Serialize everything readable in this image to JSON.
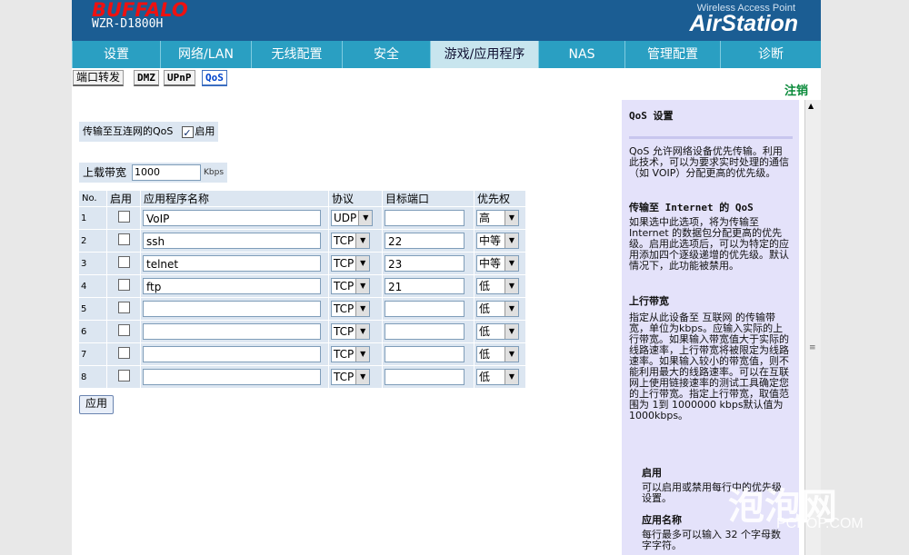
{
  "header": {
    "brand_logo": "BUFFALO",
    "model": "WZR-D1800H",
    "subtitle": "Wireless Access Point",
    "product": "AirStation"
  },
  "nav": [
    {
      "label": "设置",
      "w": 97
    },
    {
      "label": "网络/LAN",
      "w": 100
    },
    {
      "label": "无线配置",
      "w": 100
    },
    {
      "label": "安全",
      "w": 97
    },
    {
      "label": "游戏/应用程序",
      "w": 119,
      "active": true
    },
    {
      "label": "NAS",
      "w": 95
    },
    {
      "label": "管理配置",
      "w": 105
    },
    {
      "label": "诊断",
      "w": 111
    }
  ],
  "subnav": {
    "port_forward": "端口转发",
    "dmz": "DMZ",
    "upnp": "UPnP",
    "qos": "QoS",
    "logout": "注销"
  },
  "qos": {
    "label": "传输至互连网的QoS",
    "enable_label": "启用",
    "enabled": true
  },
  "bandwidth": {
    "label": "上载带宽",
    "value": "1000",
    "unit": "Kbps"
  },
  "table": {
    "headers": {
      "no": "No.",
      "enable": "启用",
      "name": "应用程序名称",
      "protocol": "协议",
      "port": "目标端口",
      "priority": "优先权"
    },
    "rows": [
      {
        "no": "1",
        "name": "VoIP",
        "protocol": "UDP",
        "port": "",
        "priority": "高"
      },
      {
        "no": "2",
        "name": "ssh",
        "protocol": "TCP",
        "port": "22",
        "priority": "中等"
      },
      {
        "no": "3",
        "name": "telnet",
        "protocol": "TCP",
        "port": "23",
        "priority": "中等"
      },
      {
        "no": "4",
        "name": "ftp",
        "protocol": "TCP",
        "port": "21",
        "priority": "低"
      },
      {
        "no": "5",
        "name": "",
        "protocol": "TCP",
        "port": "",
        "priority": "低"
      },
      {
        "no": "6",
        "name": "",
        "protocol": "TCP",
        "port": "",
        "priority": "低"
      },
      {
        "no": "7",
        "name": "",
        "protocol": "TCP",
        "port": "",
        "priority": "低"
      },
      {
        "no": "8",
        "name": "",
        "protocol": "TCP",
        "port": "",
        "priority": "低"
      }
    ]
  },
  "apply_label": "应用",
  "help": {
    "title": "QoS 设置",
    "intro": "QoS 允许网络设备优先传输。利用此技术，可以为要求实时处理的通信（如 VOIP）分配更高的优先级。",
    "s1_title": "传输至 Internet 的 QoS",
    "s1_body": "如果选中此选项，将为传输至 Internet 的数据包分配更高的优先级。启用此选项后，可以为特定的应用添加四个逐级递增的优先级。默认情况下，此功能被禁用。",
    "s2_title": "上行带宽",
    "s2_body": "指定从此设备至 互联网 的传输带宽，单位为kbps。应输入实际的上行带宽。如果输入带宽值大于实际的线路速率，上行带宽将被限定为线路速率。如果输入较小的带宽值，则不能利用最大的线路速率。可以在互联网上使用链接速率的测试工具确定您的上行带宽。指定上行带宽，取值范围为 1到 1000000 kbps默认值为 1000kbps。",
    "s3_title": "启用",
    "s3_body": "可以启用或禁用每行中的优先级设置。",
    "s4_title": "应用名称",
    "s4_body": "每行最多可以输入 32 个字母数字字符。"
  },
  "watermark": {
    "cn": "泡泡网",
    "en": "PCPOP.COM"
  }
}
